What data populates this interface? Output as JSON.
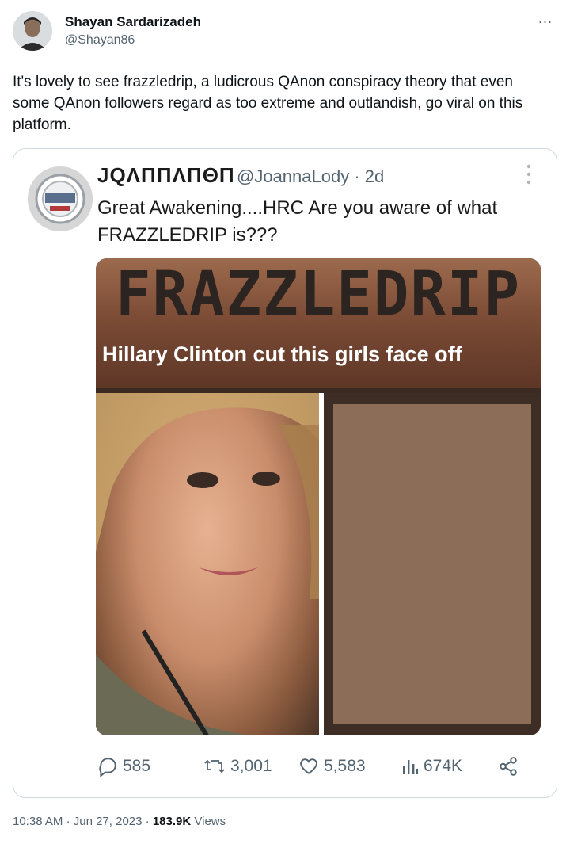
{
  "tweet": {
    "author_name": "Shayan Sardarizadeh",
    "author_handle": "@Shayan86",
    "more_label": "...",
    "text": "It's lovely to see frazzledrip, a ludicrous QAnon conspiracy theory that even some QAnon followers regard as too extreme and outlandish, go viral on this platform.",
    "time": "10:38 AM",
    "date": "Jun 27, 2023",
    "views_count": "183.9K",
    "views_label": "Views"
  },
  "embedded": {
    "name": "ЈQΛΠΠΛΠΘΠ",
    "handle_and_age": "@JoannaLody · 2d",
    "text": "Great Awakening....HRC  Are you aware of what FRAZZLEDRIP is???",
    "media": {
      "banner_title": "FRAZZLEDRIP",
      "banner_caption": "Hillary Clinton cut this girls face off"
    },
    "actions": {
      "replies": "585",
      "reposts": "3,001",
      "likes": "5,583",
      "views": "674K"
    }
  },
  "colors": {
    "secondary_text": "#536471",
    "border": "#cfd9de",
    "blur_box": "#8b6d58"
  }
}
